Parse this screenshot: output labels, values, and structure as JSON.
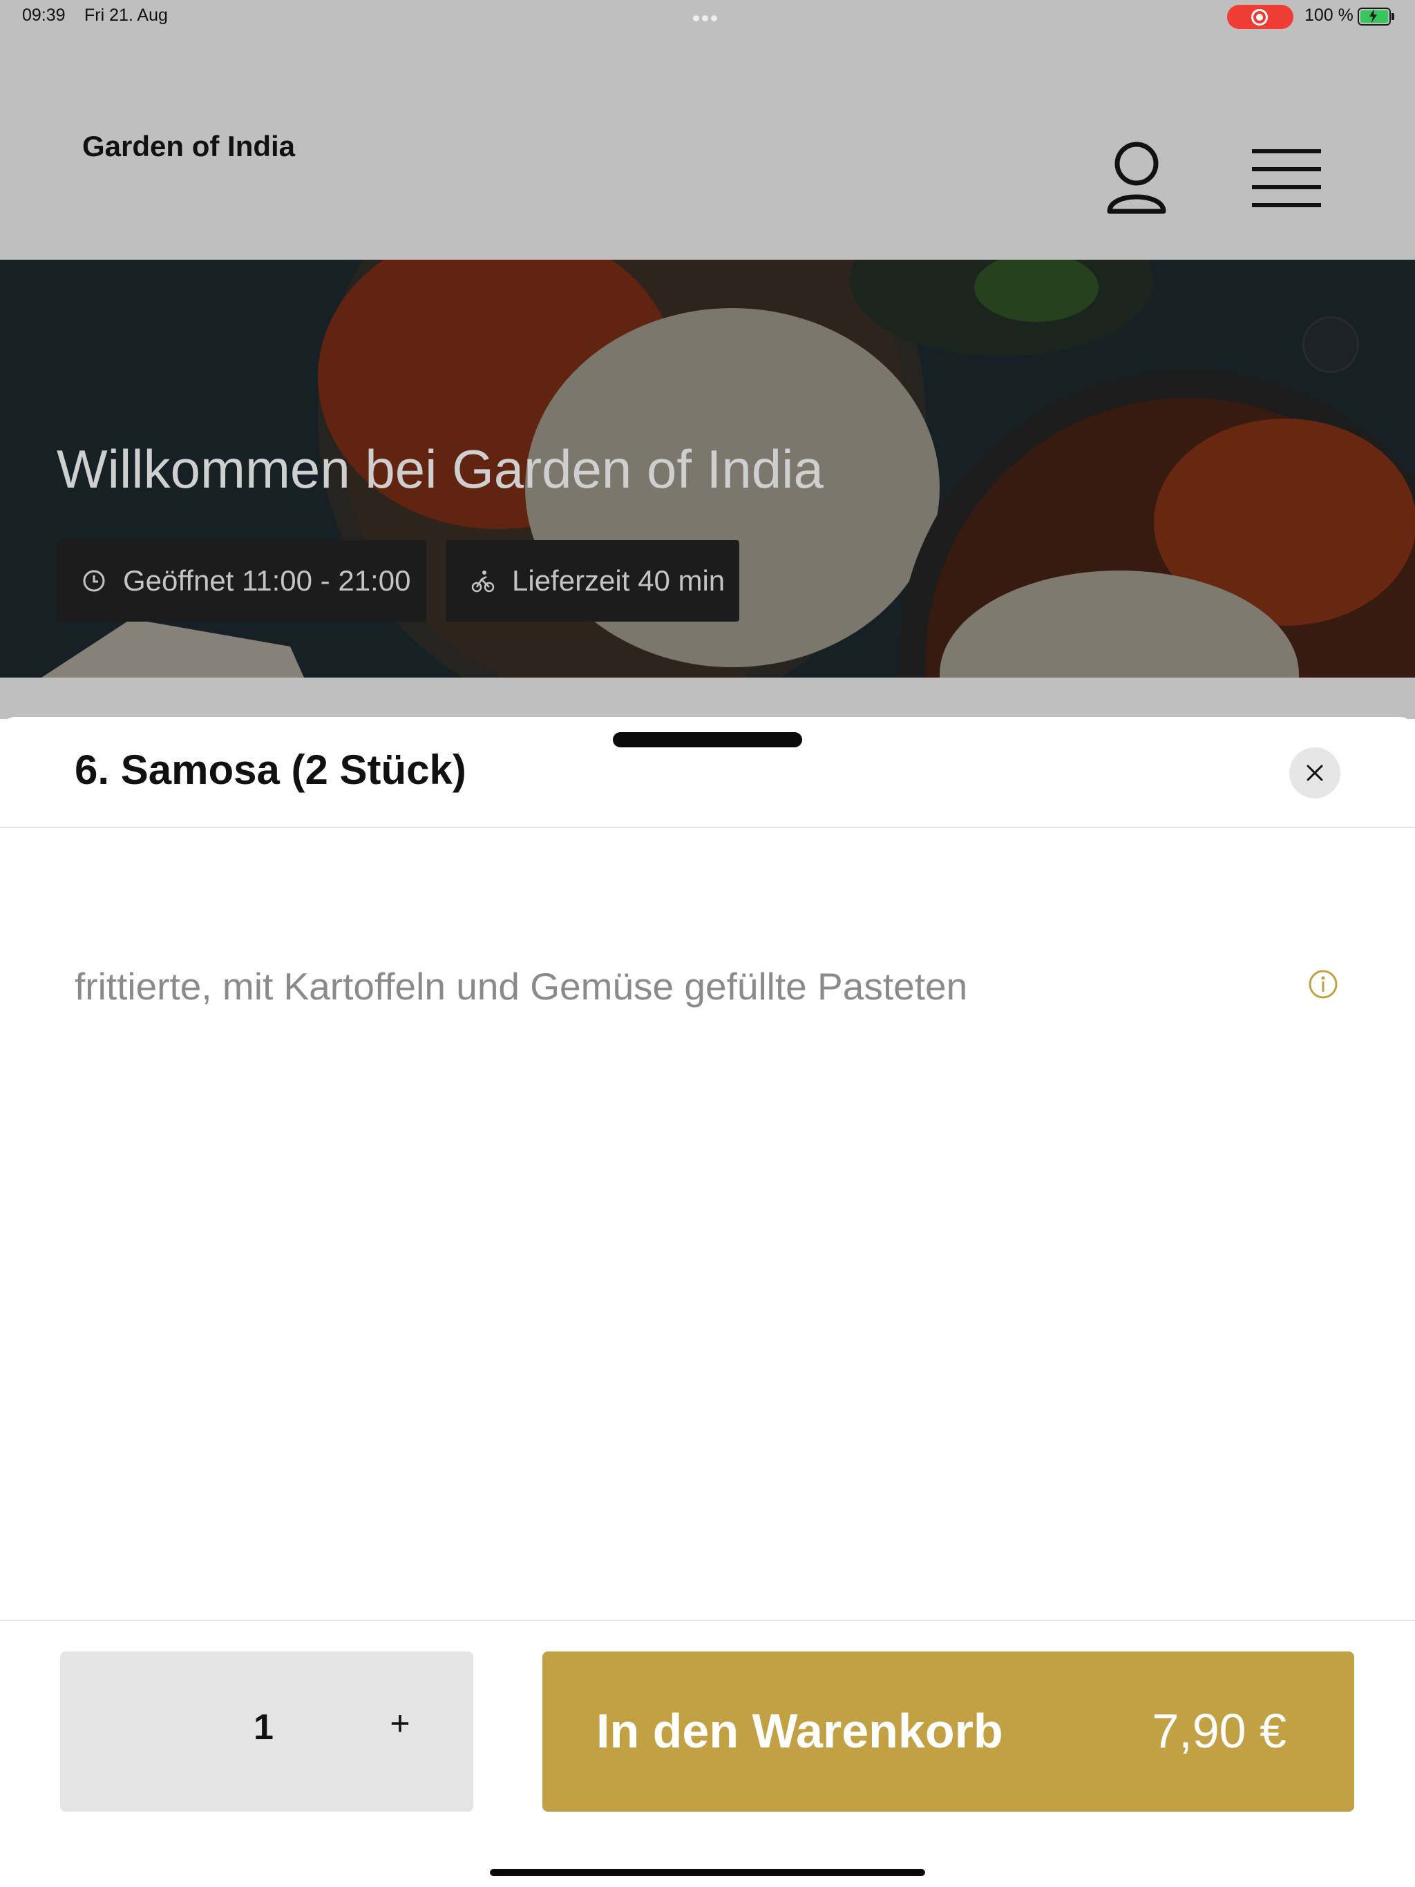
{
  "status_bar": {
    "time": "09:39",
    "date": "Fri 21. Aug",
    "battery": "100 %"
  },
  "header": {
    "brand": "Garden of India",
    "icons": [
      "user-icon",
      "hamburger-menu-icon"
    ]
  },
  "hero": {
    "title": "Willkommen bei Garden of India",
    "open_hours": "Geöffnet 11:00 - 21:00",
    "delivery_time": "Lieferzeit 40 min",
    "icons": [
      "clock-icon",
      "cyclist-icon",
      "halal-icon"
    ]
  },
  "item_sheet": {
    "title": "6. Samosa (2 Stück)",
    "description": "frittierte, mit Kartoffeln und Gemüse gefüllte Pasteten",
    "quantity": "1",
    "plus": "+",
    "add_to_cart_label": "In den Warenkorb",
    "price": "7,90 €",
    "icons": [
      "close-icon",
      "info-icon"
    ]
  },
  "colors": {
    "accent": "#c2a144",
    "overlay_gray": "#bfbfbf",
    "recording": "#ef3d36"
  }
}
